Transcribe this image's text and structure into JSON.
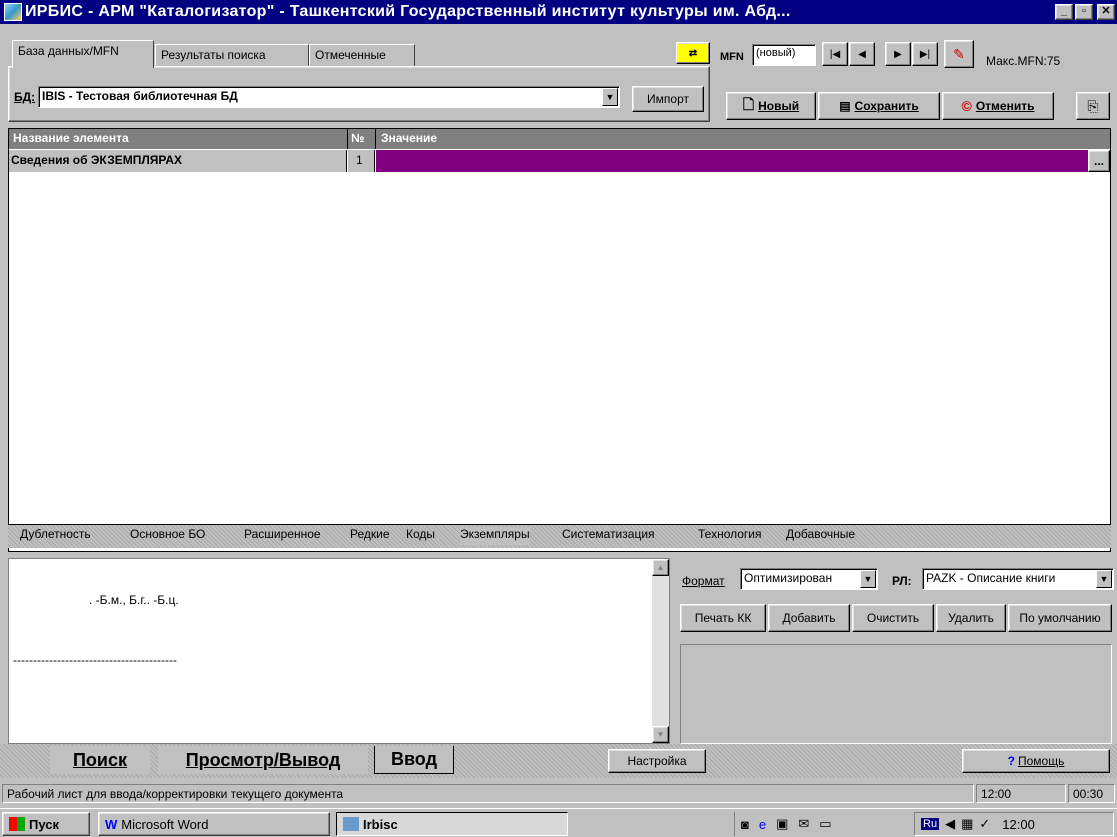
{
  "window": {
    "title": "ИРБИС - АРМ \"Каталогизатор\" - Ташкентский Государственный институт культуры им. Абд...",
    "min": "_",
    "max": "▫",
    "close": "✕"
  },
  "tabs": {
    "t1": "База данных/MFN",
    "t2": "Результаты поиска",
    "t3": "Отмеченные"
  },
  "db": {
    "label": "БД:",
    "value": "IBIS - Тестовая библиотечная БД",
    "import": "Импорт"
  },
  "mfn": {
    "label": "MFN",
    "value": "(новый)",
    "max": "Макс.MFN:75"
  },
  "actions": {
    "new": "Новый",
    "save": "Сохранить",
    "cancel": "Отменить"
  },
  "grid": {
    "col_name": "Название элемента",
    "col_num": "№",
    "col_value": "Значение",
    "row_name": "Сведения  об ЭКЗЕМПЛЯРАХ",
    "row_num": "1",
    "row_btn": "...",
    "row_color": "#800080"
  },
  "worksheet_tabs": {
    "t1": "Дублетность",
    "t2": "Основное БО",
    "t3": "Расширенное",
    "t4": "Редкие",
    "t5": "Коды",
    "t6": "Экземпляры",
    "t7": "Систематизация",
    "t8": "Технология",
    "t9": "Добавочные"
  },
  "preview": {
    "line1": ". -Б.м., Б.г.. -Б.ц.",
    "line2": "-----------------------------------------"
  },
  "format": {
    "format_label": "Формат",
    "format_value": "Оптимизирован",
    "rl_label": "РЛ:",
    "rl_value": "PAZK - Описание книги"
  },
  "buttons": {
    "print": "Печать КК",
    "add": "Добавить",
    "clear": "Очистить",
    "delete": "Удалить",
    "default": "По умолчанию"
  },
  "modes": {
    "search": "Поиск",
    "view": "Просмотр/Вывод",
    "input": "Ввод",
    "settings": "Настройка",
    "help": "Помощь"
  },
  "status": {
    "text": "Рабочий лист для ввода/корректировки текущего документа",
    "time1": "12:00",
    "time2": "00:30"
  },
  "taskbar": {
    "start": "Пуск",
    "word": "Microsoft Word",
    "irbis": "Irbisc",
    "clock": "12:00",
    "lang": "Ru"
  }
}
